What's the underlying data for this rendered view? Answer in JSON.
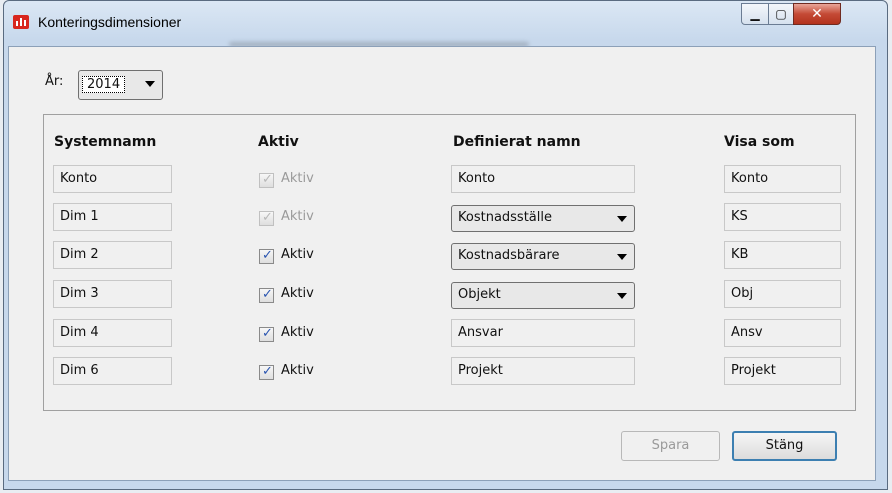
{
  "window": {
    "title": "Konteringsdimensioner"
  },
  "year": {
    "label": "År:",
    "value": "2014"
  },
  "headers": {
    "system": "Systemnamn",
    "active": "Aktiv",
    "defined": "Definierat namn",
    "show": "Visa som"
  },
  "rows": [
    {
      "system": "Konto",
      "active_label": "Aktiv",
      "checked": true,
      "enabled": false,
      "defined": "Konto",
      "defined_dropdown": false,
      "show": "Konto"
    },
    {
      "system": "Dim 1",
      "active_label": "Aktiv",
      "checked": true,
      "enabled": false,
      "defined": "Kostnadsställe",
      "defined_dropdown": true,
      "show": "KS"
    },
    {
      "system": "Dim 2",
      "active_label": "Aktiv",
      "checked": true,
      "enabled": true,
      "defined": "Kostnadsbärare",
      "defined_dropdown": true,
      "show": "KB"
    },
    {
      "system": "Dim 3",
      "active_label": "Aktiv",
      "checked": true,
      "enabled": true,
      "defined": "Objekt",
      "defined_dropdown": true,
      "show": "Obj"
    },
    {
      "system": "Dim 4",
      "active_label": "Aktiv",
      "checked": true,
      "enabled": true,
      "defined": "Ansvar",
      "defined_dropdown": false,
      "show": "Ansv"
    },
    {
      "system": "Dim 6",
      "active_label": "Aktiv",
      "checked": true,
      "enabled": true,
      "defined": "Projekt",
      "defined_dropdown": false,
      "show": "Projekt"
    }
  ],
  "buttons": {
    "save": "Spara",
    "close": "Stäng"
  },
  "icons": {
    "app": "app-logo-icon",
    "minimize": "minimize-icon",
    "maximize": "maximize-icon",
    "close": "close-icon",
    "checkbox": "checkmark-icon",
    "dropdown": "chevron-down-icon"
  }
}
